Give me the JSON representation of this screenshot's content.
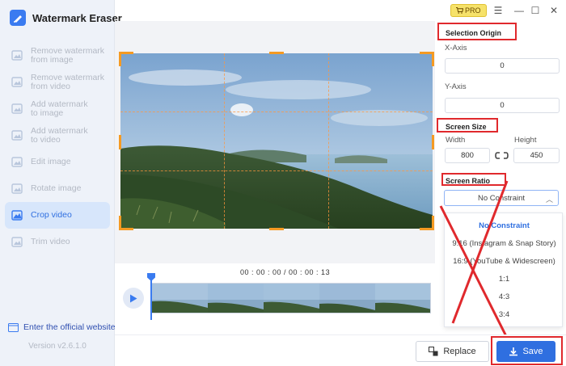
{
  "app": {
    "title": "Watermark Eraser",
    "version": "Version v2.6.1.0",
    "website_link": "Enter the official website"
  },
  "titlebar": {
    "pro_label": "PRO"
  },
  "sidebar": {
    "items": [
      {
        "label": "Remove watermark\nfrom image",
        "icon": "image-erase-icon"
      },
      {
        "label": "Remove watermark\nfrom video",
        "icon": "video-erase-icon"
      },
      {
        "label": "Add watermark\nto image",
        "icon": "image-add-icon"
      },
      {
        "label": "Add watermark\nto video",
        "icon": "video-add-icon"
      },
      {
        "label": "Edit image",
        "icon": "edit-image-icon"
      },
      {
        "label": "Rotate image",
        "icon": "rotate-icon"
      },
      {
        "label": "Crop video",
        "icon": "crop-icon",
        "active": true
      },
      {
        "label": "Trim video",
        "icon": "trim-icon"
      }
    ]
  },
  "timeline": {
    "timecode": "00 : 00 : 00 / 00 : 00 : 13"
  },
  "panel": {
    "selection_origin": {
      "title": "Selection Origin",
      "x_label": "X-Axis",
      "x_value": "0",
      "y_label": "Y-Axis",
      "y_value": "0"
    },
    "screen_size": {
      "title": "Screen Size",
      "width_label": "Width",
      "height_label": "Height",
      "width_value": "800",
      "height_value": "450"
    },
    "screen_ratio": {
      "title": "Screen Ratio",
      "selected": "No Constraint",
      "options": [
        "No Constraint",
        "9:16 (Instagram & Snap Story)",
        "16:9 (YouTube & Widescreen)",
        "1:1",
        "4:3",
        "3:4"
      ]
    }
  },
  "buttons": {
    "replace": "Replace",
    "save": "Save"
  },
  "colors": {
    "accent": "#2f6fe0",
    "highlight_box": "#e0292d",
    "crop_handle": "#f59a23",
    "pro_badge": "#f6e26a"
  }
}
